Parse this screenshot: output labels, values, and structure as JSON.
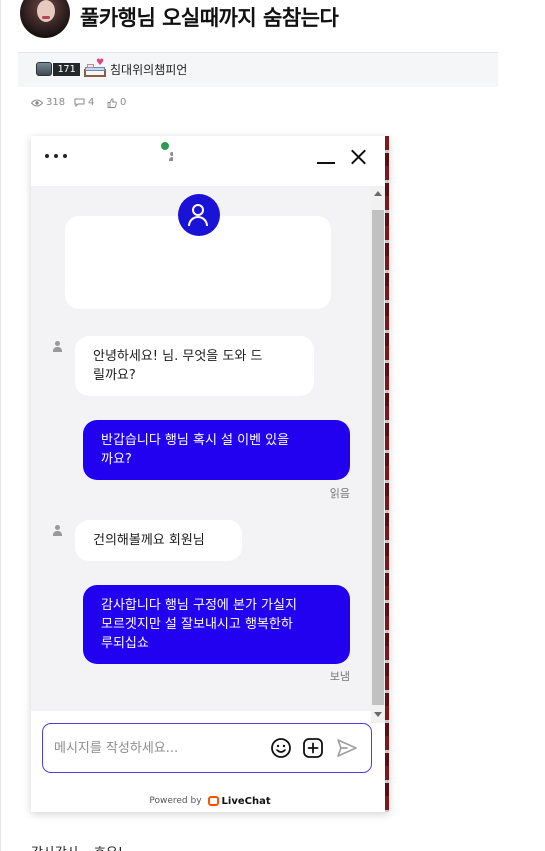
{
  "post": {
    "title": "풀카행님 오실때까지 숨참는다",
    "author": {
      "level": "171",
      "nickname": "침대위의챔피언"
    },
    "stats": {
      "views": "318",
      "comments": "4",
      "likes": "0"
    }
  },
  "chat": {
    "messages": [
      {
        "from": "agent",
        "text": "안녕하세요! 님. 무엇을 도와 드\n릴까요?"
      },
      {
        "from": "visitor",
        "text": "반갑습니다 행님 혹시 설 이벤 있을\n까요?",
        "status": "읽음"
      },
      {
        "from": "agent",
        "text": "건의해볼께요 회원님"
      },
      {
        "from": "visitor",
        "text": "감사합니다 행님 구정에 본가 가실지\n모르겟지만 설 잘보내시고 행복한하\n루되십쇼",
        "status": "보냄"
      }
    ],
    "composer": {
      "placeholder": "메시지를 작성하세요..."
    },
    "powered_by": "Powered by",
    "brand": "LiveChat",
    "colors": {
      "accent": "#2200f0",
      "online": "#2c9a53",
      "brand": "#ff5100"
    }
  },
  "footer": {
    "text": "감사감사~ 호우!"
  }
}
